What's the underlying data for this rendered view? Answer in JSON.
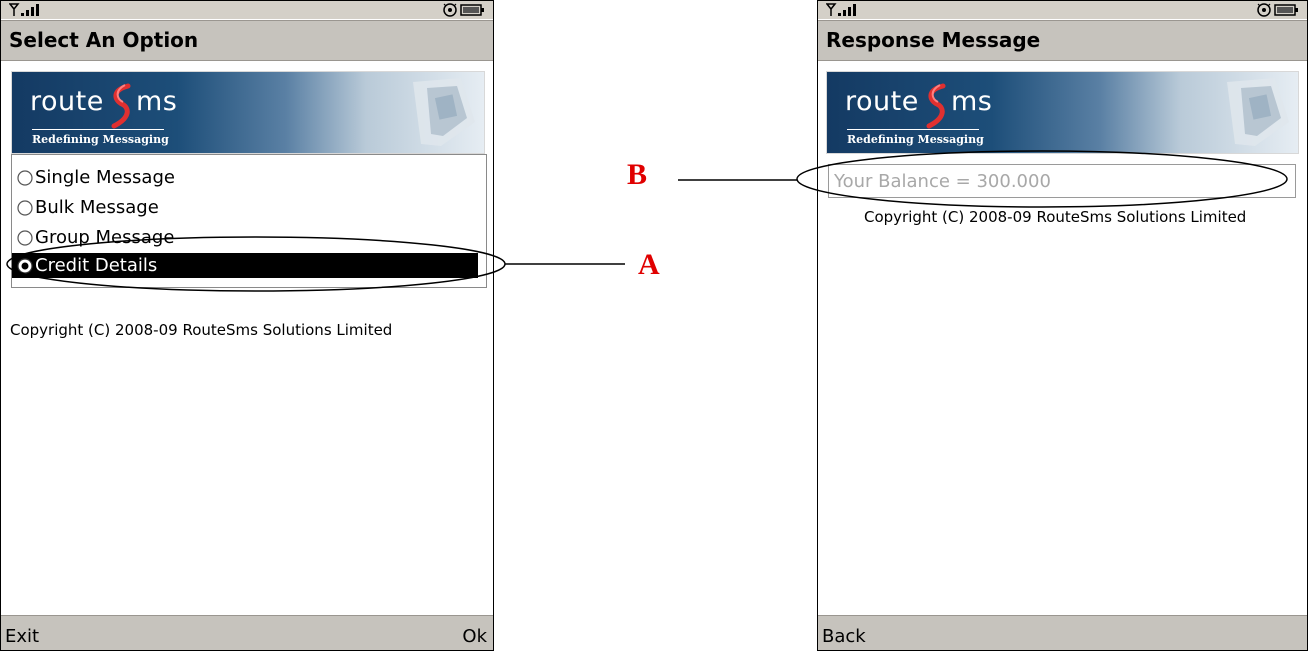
{
  "left_screen": {
    "title": "Select An Option",
    "banner": {
      "logo_left": "route",
      "logo_right": "ms",
      "tagline": "Redefining Messaging"
    },
    "options": [
      {
        "label": "Single Message",
        "selected": false
      },
      {
        "label": "Bulk Message",
        "selected": false
      },
      {
        "label": "Group Message",
        "selected": false
      },
      {
        "label": "Credit Details",
        "selected": true
      }
    ],
    "copyright": "Copyright (C) 2008-09 RouteSms Solutions Limited",
    "softkeys": {
      "left": "Exit",
      "right": "Ok"
    }
  },
  "right_screen": {
    "title": "Response Message",
    "banner": {
      "logo_left": "route",
      "logo_right": "ms",
      "tagline": "Redefining Messaging"
    },
    "balance": "Your Balance = 300.000",
    "copyright": "Copyright (C) 2008-09 RouteSms Solutions Limited",
    "softkeys": {
      "left": "Back"
    }
  },
  "annotations": {
    "a": "A",
    "b": "B"
  },
  "colors": {
    "annotation": "#e00000",
    "selection": "#000000",
    "bars": "#c6c3bd"
  }
}
